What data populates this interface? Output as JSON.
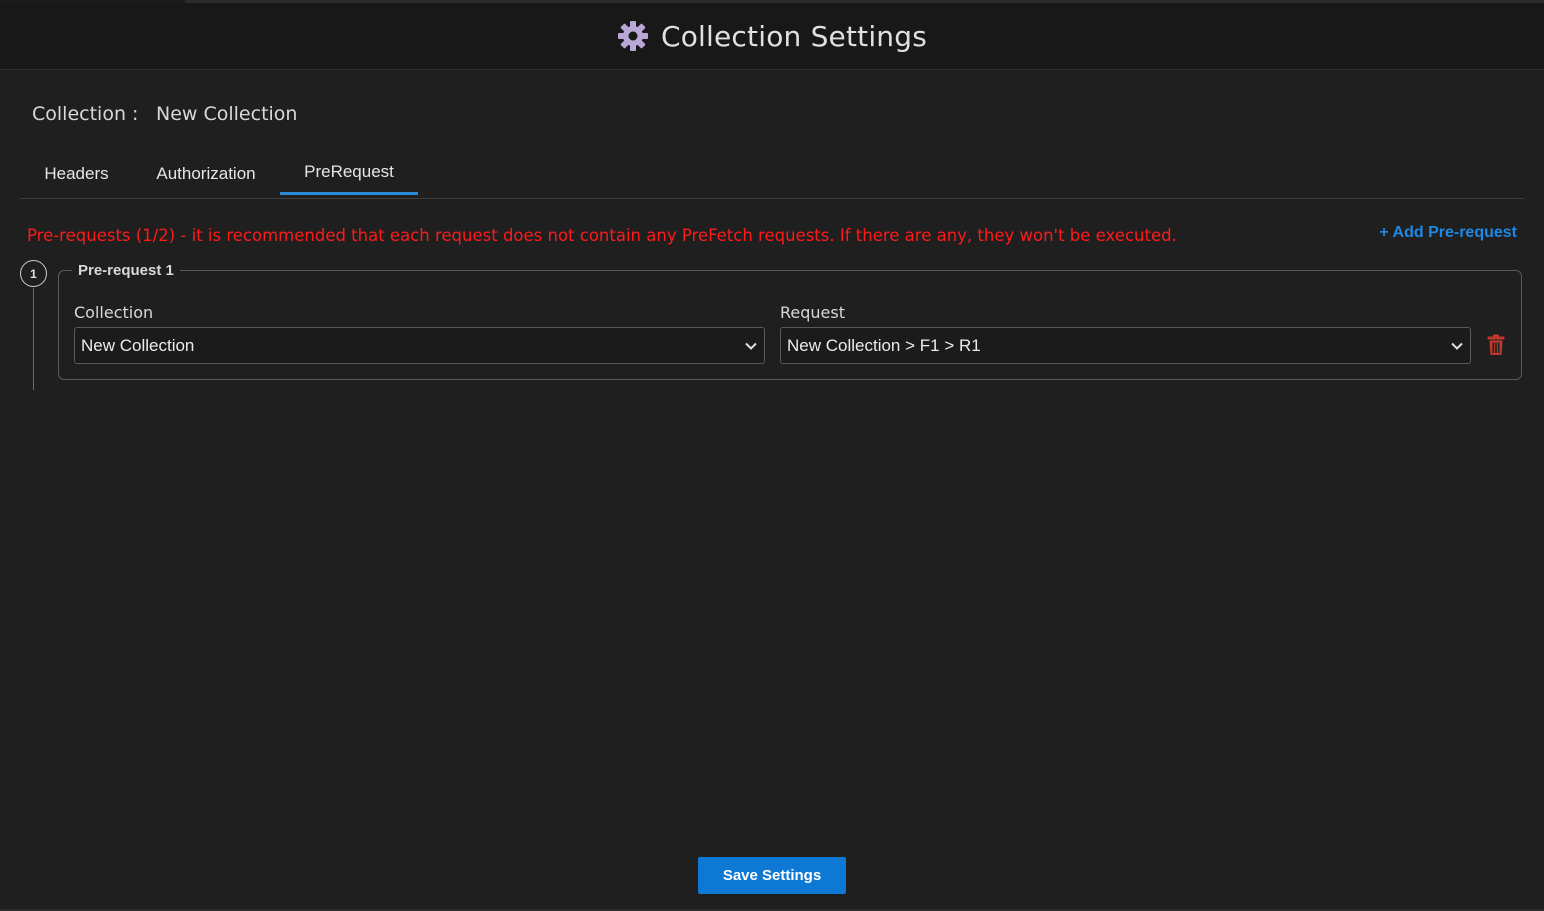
{
  "header": {
    "title": "Collection Settings",
    "icon": "gear-icon"
  },
  "collection": {
    "label": "Collection :",
    "name": "New Collection"
  },
  "tabs": [
    {
      "label": "Headers",
      "active": false
    },
    {
      "label": "Authorization",
      "active": false
    },
    {
      "label": "PreRequest",
      "active": true
    }
  ],
  "prerequest": {
    "warning": "Pre-requests (1/2) - it is recommended that each request does not contain any PreFetch requests. If there are any, they won't be executed.",
    "add_label": "+ Add Pre-request",
    "items": [
      {
        "step": "1",
        "legend": "Pre-request 1",
        "collection_label": "Collection",
        "collection_value": "New Collection",
        "request_label": "Request",
        "request_value": "New Collection > F1 > R1"
      }
    ]
  },
  "footer": {
    "save_label": "Save Settings"
  },
  "colors": {
    "accent": "#0e78d5",
    "link": "#1e88e5",
    "warning": "#ff1a1a",
    "delete": "#c0392b",
    "gear": "#b9a7d6"
  }
}
